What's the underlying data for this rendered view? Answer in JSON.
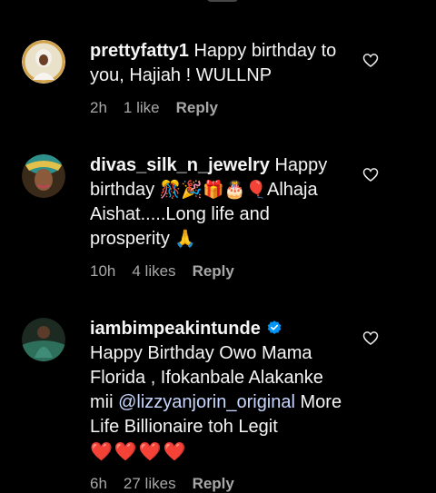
{
  "comments": [
    {
      "username": "prettyfatty1",
      "text": "Happy birthday to you, Hajiah ! WULLNP",
      "time": "2h",
      "likes": "1 like",
      "reply_label": "Reply"
    },
    {
      "username": "divas_silk_n_jewelry",
      "text_a": "Happy birthday",
      "emojis_a": "🎊🎉🎁🎂🎈",
      "text_b": "Alhaja Aishat.....Long life and prosperity",
      "emoji_b": "🙏",
      "time": "10h",
      "likes": "4 likes",
      "reply_label": "Reply"
    },
    {
      "username": "iambimpeakintunde",
      "verified": true,
      "text_a": "Happy Birthday Owo Mama Florida , Ifokanbale Alakanke mii",
      "mention": "@lizzyanjorin_original",
      "text_b": "More Life Billionaire toh Legit",
      "hearts": "❤️❤️❤️❤️",
      "time": "6h",
      "likes": "27 likes",
      "reply_label": "Reply"
    }
  ],
  "colors": {
    "background": "#000000",
    "text": "#f5f5f5",
    "meta": "#a8a8a8",
    "verified": "#0095f6"
  },
  "icons": {
    "like": "heart-outline-icon",
    "verified": "verified-badge-icon"
  }
}
